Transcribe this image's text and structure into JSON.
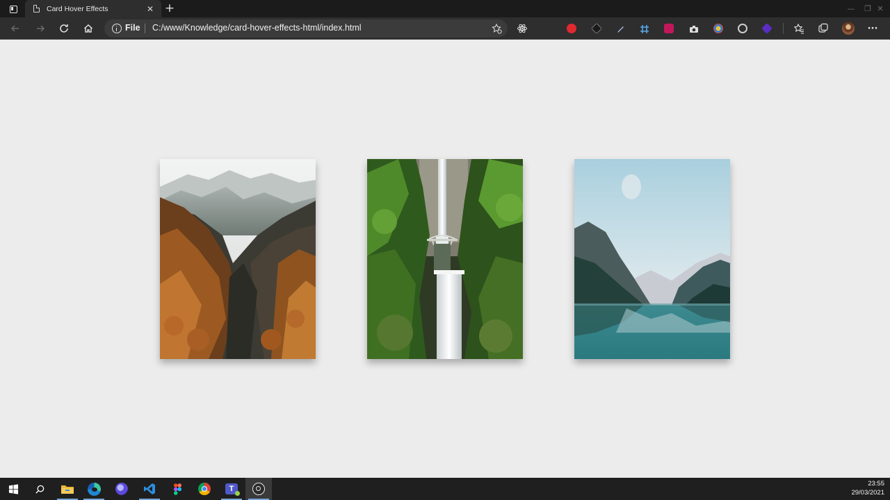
{
  "browser": {
    "tab_title": "Card Hover Effects",
    "tab_close": "✕",
    "new_tab": "+",
    "address": {
      "scheme_label": "File",
      "url": "C:/www/Knowledge/card-hover-effects-html/index.html"
    },
    "window_controls": [
      "—",
      "❐",
      "✕"
    ],
    "more_menu": "···"
  },
  "cards": [
    {
      "name": "autumn-mountain-valley",
      "alt_theme": "misty mountains with orange autumn forest"
    },
    {
      "name": "multnomah-waterfall",
      "alt_theme": "waterfall with stone footbridge in green forest"
    },
    {
      "name": "mountain-lake",
      "alt_theme": "turquoise lake with mountain reflection"
    }
  ],
  "taskbar": {
    "time": "23:55",
    "date": "29/03/2021"
  },
  "colors": {
    "chrome_dark": "#1b1b1b",
    "toolbar": "#2e2e2e",
    "page_bg": "#ececec",
    "taskbar": "#1f1f1f"
  }
}
